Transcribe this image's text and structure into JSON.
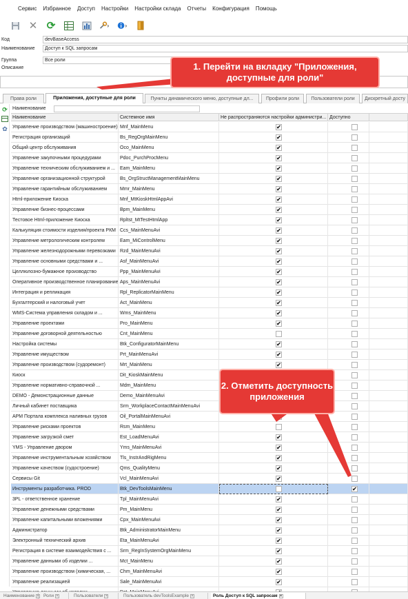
{
  "menu": [
    "Сервис",
    "Избранное",
    "Доступ",
    "Настройки",
    "Настройки склада",
    "Отчеты",
    "Конфигурация",
    "Помощь"
  ],
  "form": {
    "kod_label": "Код",
    "kod_value": "devBaseAccess",
    "name_label": "Наименование",
    "name_value": "Доступ к SQL запросам",
    "group_label": "Группа",
    "group_value": "Все роли",
    "desc_label": "Описание"
  },
  "callouts": {
    "step1": "1. Перейти на вкладку \"Приложения, доступные для роли\"",
    "step2": "2. Отметить доступность приложения"
  },
  "tabs": [
    "Права роли",
    "Приложения, доступные для роли",
    "Пункты динамического меню, доступные дл...",
    "Профили роли",
    "Пользователи роли",
    "Дискретный досту"
  ],
  "filter": {
    "label": "Наименование",
    "value": ""
  },
  "columns": [
    "Наименование",
    "Системное имя",
    "Не распространяются настройки администри...",
    "Доступно"
  ],
  "rows": [
    {
      "name": "Управление производством (машиностроение)",
      "sys": "Mnf_MainMenu",
      "na": true,
      "av": false
    },
    {
      "name": "Регистрация организаций",
      "sys": "Bs_RegOrgMainMenu",
      "na": true,
      "av": false
    },
    {
      "name": "Общий центр обслуживания",
      "sys": "Oco_MainMenu",
      "na": true,
      "av": false
    },
    {
      "name": "Управление закупочными процедурами",
      "sys": "Pdoc_PurchProcMenu",
      "na": true,
      "av": false
    },
    {
      "name": "Управление техническим обслуживанием и ...",
      "sys": "Eam_MainMenu",
      "na": true,
      "av": false
    },
    {
      "name": "Управление организационной структурой",
      "sys": "Bs_OrgStructManagementMainMenu",
      "na": true,
      "av": false
    },
    {
      "name": "Управление гарантийным обслуживанием",
      "sys": "Mmr_MainMenu",
      "na": true,
      "av": false
    },
    {
      "name": "Html-приложение Киоска",
      "sys": "Mnf_MtKioskHtmlAppAvi",
      "na": true,
      "av": false
    },
    {
      "name": "Управление бизнес-процессами",
      "sys": "Bpm_MainMenu",
      "na": true,
      "av": false
    },
    {
      "name": "Тестовое Html-приложение Киоска",
      "sys": "Rpltst_MtTestHtmlApp",
      "na": true,
      "av": false
    },
    {
      "name": "Калькуляция стоимости изделия/проекта РКМ",
      "sys": "Ccs_MainMenuAvi",
      "na": true,
      "av": false
    },
    {
      "name": "Управление метрологическим контролем",
      "sys": "Eam_MiControlMenu",
      "na": true,
      "av": false
    },
    {
      "name": "Управление железнодорожными перевозками",
      "sys": "Rzd_MainMenuAvi",
      "na": true,
      "av": false
    },
    {
      "name": "Управление основными средствами и ...",
      "sys": "Asf_MainMenuAvi",
      "na": true,
      "av": false
    },
    {
      "name": "Целлюлозно-бумажное производство",
      "sys": "Ppp_MainMenuAvi",
      "na": true,
      "av": false
    },
    {
      "name": "Оперативное производственное планирование",
      "sys": "Aps_MainMenuAvi",
      "na": true,
      "av": false
    },
    {
      "name": "Интеграция и репликация",
      "sys": "Rpl_ReplicatorMainMenu",
      "na": true,
      "av": false
    },
    {
      "name": "Бухгалтерский и налоговый учет",
      "sys": "Act_MainMenu",
      "na": true,
      "av": false
    },
    {
      "name": "WMS-Система управления складом и ...",
      "sys": "Wms_MainMenu",
      "na": true,
      "av": false
    },
    {
      "name": "Управление проектами",
      "sys": "Pro_MainMenu",
      "na": true,
      "av": false
    },
    {
      "name": "Управление договорной деятельностью",
      "sys": "Cnt_MainMenu",
      "na": false,
      "av": false
    },
    {
      "name": "Настройка системы",
      "sys": "Btk_ConfiguratorMainMenu",
      "na": true,
      "av": false
    },
    {
      "name": "Управление имуществом",
      "sys": "Prt_MainMenuAvi",
      "na": true,
      "av": false
    },
    {
      "name": "Управление производством (судоремонт)",
      "sys": "Mrt_MainMenu",
      "na": true,
      "av": false
    },
    {
      "name": "Киоск",
      "sys": "Dit_KioskMainMenu",
      "na": false,
      "av": false
    },
    {
      "name": "Управление нормативно-справочной ...",
      "sys": "Mdm_MainMenu",
      "na": false,
      "av": false
    },
    {
      "name": "DEMO - Демонстрационные данные",
      "sys": "Demo_MainMenuAvi",
      "na": false,
      "av": false
    },
    {
      "name": "Личный кабинет поставщика",
      "sys": "Srm_WorkplaceContactMainMenuAvi",
      "na": false,
      "av": false
    },
    {
      "name": "АРМ Портала комплекса наливных грузов",
      "sys": "Oil_PortalMainMenuAvi",
      "na": false,
      "av": false
    },
    {
      "name": "Управление рисками проектов",
      "sys": "Rsm_MainMenu",
      "na": false,
      "av": false
    },
    {
      "name": "Управление загрузкой смет",
      "sys": "Est_LoadMenuAvi",
      "na": true,
      "av": false
    },
    {
      "name": "YMS - Управление двором",
      "sys": "Yms_MainMenuAvi",
      "na": true,
      "av": false
    },
    {
      "name": "Управление инструментальным хозяйством",
      "sys": "Tls_InstrAndRigMenu",
      "na": true,
      "av": false
    },
    {
      "name": "Управление качеством (судостроение)",
      "sys": "Qms_QualityMenu",
      "na": true,
      "av": false
    },
    {
      "name": "Сервисы Git",
      "sys": "Vcl_MainMenuAvi",
      "na": true,
      "av": false
    },
    {
      "name": "Инструменты разработчика. PROD",
      "sys": "Btk_DevToolsMainMenu",
      "na": false,
      "av": true,
      "selected": true
    },
    {
      "name": "3PL - ответственное хранение",
      "sys": "Tpl_MainMenuAvi",
      "na": true,
      "av": false
    },
    {
      "name": "Управление денежными средствами",
      "sys": "Pm_MainMenu",
      "na": true,
      "av": false
    },
    {
      "name": "Управление капитальными вложениями",
      "sys": "Cpx_MainMenuAvi",
      "na": true,
      "av": false
    },
    {
      "name": "Администратор",
      "sys": "Btk_AdministratorMainMenu",
      "na": true,
      "av": false
    },
    {
      "name": "Электронный технический архив",
      "sys": "Eta_MainMenuAvi",
      "na": true,
      "av": false
    },
    {
      "name": "Регистрация в системе взаимодействия с ...",
      "sys": "Srm_RegInSystemOrgMainMenu",
      "na": true,
      "av": false
    },
    {
      "name": "Управление данными об изделии ...",
      "sys": "Mct_MainMenu",
      "na": true,
      "av": false
    },
    {
      "name": "Управление производством (химическая, ...",
      "sys": "Chm_MainMenuAvi",
      "na": true,
      "av": false
    },
    {
      "name": "Управление реализацией",
      "sys": "Sale_MainMenuAvi",
      "na": true,
      "av": false
    },
    {
      "name": "Управление данными об изделии ...",
      "sys": "Dct_MainMenuAvi",
      "na": true,
      "av": false
    },
    {
      "name": "Динамическое меню",
      "sys": "Bs_DynMenuApp",
      "na": true,
      "av": false
    }
  ],
  "bottom_tabs": [
    {
      "label": "Наименование",
      "active": false
    },
    {
      "label": "Роли",
      "active": false
    },
    {
      "label": "Пользователи",
      "active": false
    },
    {
      "label": "Пользователь devToolsExample",
      "active": false
    },
    {
      "label": "Роль Доступ к SQL запросам",
      "active": true
    }
  ],
  "icons": {
    "save": "save-icon",
    "cancel": "close-icon",
    "refresh": "refresh-icon",
    "grid": "grid-icon",
    "chart": "chart-icon",
    "tools": "tools-icon",
    "info": "info-icon",
    "exit": "exit-icon"
  },
  "colors": {
    "callout": "#e53935",
    "selection": "#bcd4f2",
    "refresh": "#2e9e3a",
    "info": "#1e73d6"
  }
}
